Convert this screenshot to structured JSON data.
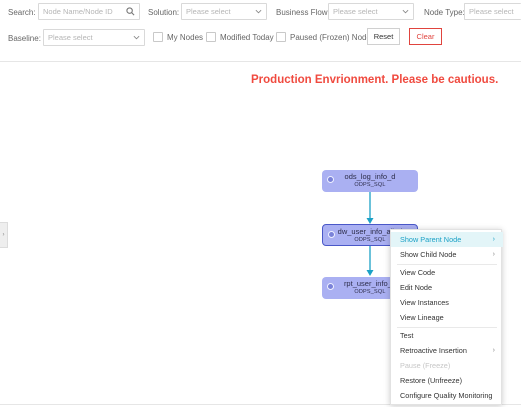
{
  "filters": {
    "search_label": "Search:",
    "search_placeholder": "Node Name/Node ID",
    "solution_label": "Solution:",
    "solution_placeholder": "Please select",
    "business_flow_label": "Business Flow:",
    "business_flow_placeholder": "Please select",
    "node_type_label": "Node Type:",
    "node_type_placeholder": "Please select",
    "baseline_label": "Baseline:",
    "baseline_placeholder": "Please select",
    "my_nodes_label": "My Nodes",
    "modified_today_label": "Modified Today",
    "paused_label": "Paused (Frozen) Node",
    "reset_label": "Reset",
    "clear_label": "Clear"
  },
  "banner": {
    "warning": "Production Envrionment. Please be cautious.",
    "warning_color": "#f04a3f"
  },
  "nodes": [
    {
      "name": "ods_log_info_d",
      "type": "ODPS_SQL",
      "selected": false
    },
    {
      "name": "dw_user_info_all_d",
      "type": "ODPS_SQL",
      "selected": true
    },
    {
      "name": "rpt_user_info_d",
      "type": "ODPS_SQL",
      "selected": false
    }
  ],
  "context_menu": {
    "items": [
      {
        "label": "Show Parent Node",
        "submenu": true,
        "highlighted": true,
        "disabled": false
      },
      {
        "label": "Show Child Node",
        "submenu": true,
        "highlighted": false,
        "disabled": false
      },
      {
        "label": "View Code",
        "submenu": false,
        "highlighted": false,
        "disabled": false
      },
      {
        "label": "Edit Node",
        "submenu": false,
        "highlighted": false,
        "disabled": false
      },
      {
        "label": "View Instances",
        "submenu": false,
        "highlighted": false,
        "disabled": false
      },
      {
        "label": "View Lineage",
        "submenu": false,
        "highlighted": false,
        "disabled": false
      },
      {
        "label": "Test",
        "submenu": false,
        "highlighted": false,
        "disabled": false
      },
      {
        "label": "Retroactive Insertion",
        "submenu": true,
        "highlighted": false,
        "disabled": false
      },
      {
        "label": "Pause (Freeze)",
        "submenu": false,
        "highlighted": false,
        "disabled": true
      },
      {
        "label": "Restore (Unfreeze)",
        "submenu": false,
        "highlighted": false,
        "disabled": false
      },
      {
        "label": "Configure Quality Monitoring",
        "submenu": false,
        "highlighted": false,
        "disabled": false
      }
    ]
  },
  "colors": {
    "node_fill": "#aab0f2",
    "selected_node_border": "#4a58c8",
    "edge": "#1ba1c6",
    "menu_highlight_bg": "#e3f5f8",
    "menu_highlight_text": "#1ba1c6",
    "clear_button": "#e0443e"
  },
  "icons": {
    "search": "search-icon",
    "dropdown": "chevron-down-icon",
    "submenu": "chevron-right-icon",
    "collapse": "collapse-panel-icon"
  }
}
